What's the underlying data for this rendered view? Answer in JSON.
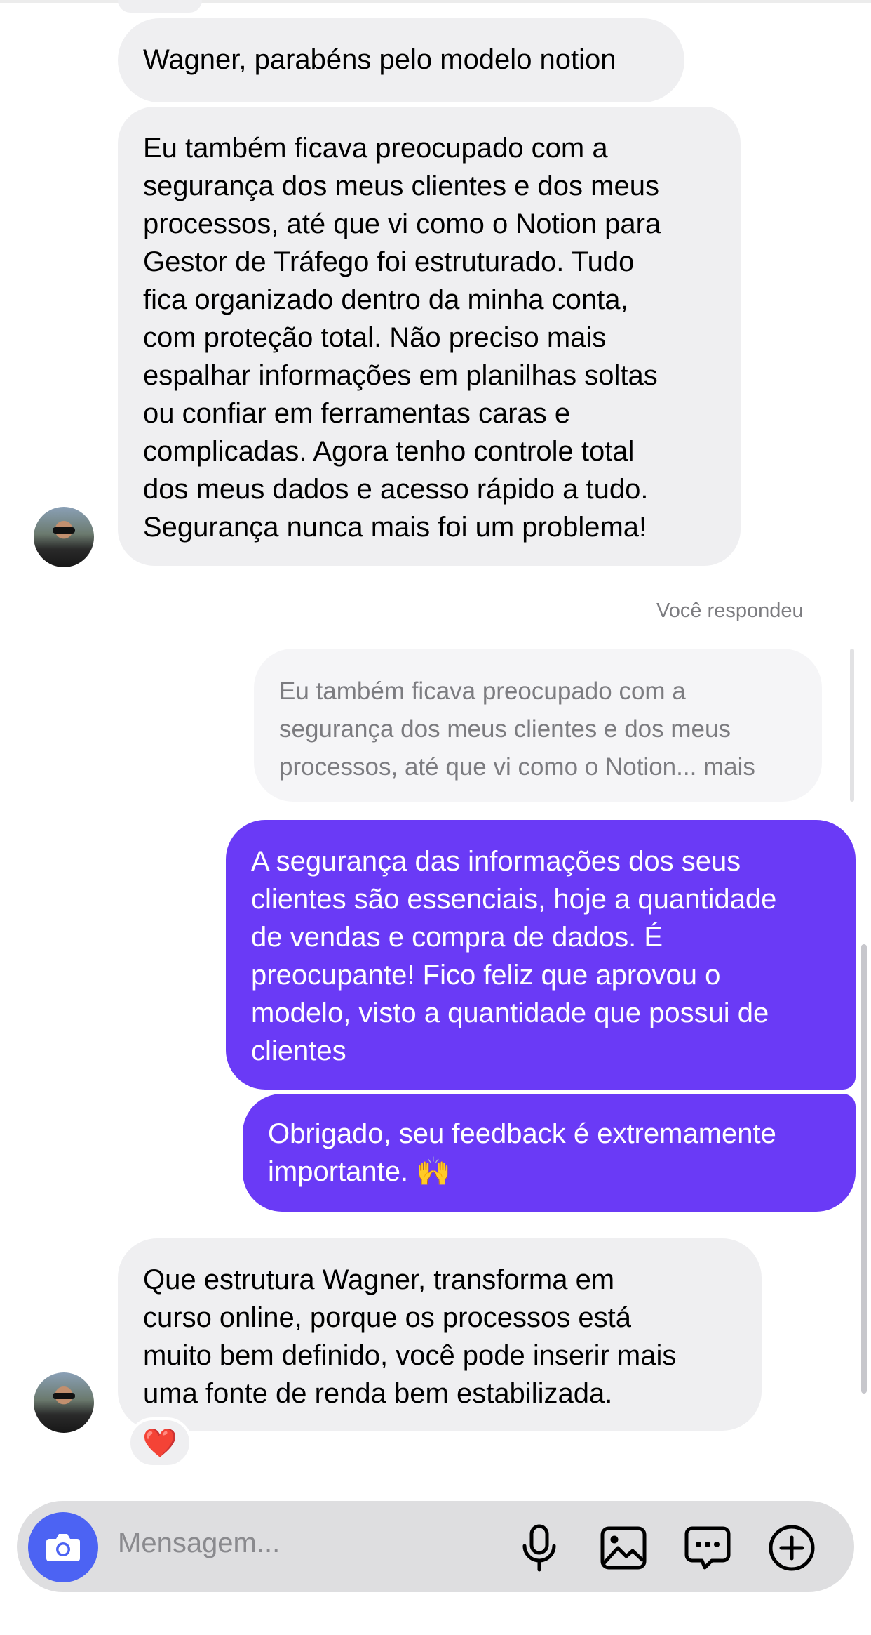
{
  "messages": {
    "m1": "Wagner, parabéns pelo modelo notion",
    "m2_lines": [
      "Eu também ficava preocupado com a",
      "segurança dos meus clientes e dos meus",
      "processos, até que vi como o Notion para",
      "Gestor de Tráfego foi estruturado. Tudo",
      "fica organizado dentro da minha conta,",
      "com proteção total. Não preciso mais",
      "espalhar informações em planilhas soltas",
      "ou confiar em ferramentas caras e",
      "complicadas. Agora tenho controle total",
      "dos meus dados e acesso rápido a tudo.",
      "Segurança nunca mais foi um problema!"
    ],
    "replied_label": "Você respondeu",
    "quote_lines": [
      "Eu também ficava preocupado com a",
      "segurança dos meus clientes e dos meus",
      "processos, até que vi como o Notion... mais"
    ],
    "out1_lines": [
      "A segurança das informações dos seus",
      "clientes são essenciais, hoje a quantidade",
      "de vendas e compra de dados. É",
      "preocupante! Fico feliz que aprovou o",
      "modelo, visto a quantidade que possui de",
      "clientes"
    ],
    "out2_lines": [
      "Obrigado, seu feedback é extremamente",
      "importante. 🙌"
    ],
    "in3_lines": [
      "Que estrutura Wagner, transforma em",
      "curso online, porque os processos está",
      "muito bem definido, você pode inserir mais",
      "uma fonte de renda bem estabilizada."
    ],
    "reaction": "❤️"
  },
  "composer": {
    "placeholder": "Mensagem...",
    "icons": [
      "camera-icon",
      "microphone-icon",
      "image-icon",
      "sticker-icon",
      "plus-icon"
    ]
  },
  "colors": {
    "outgoing_bubble": "#6a3af6",
    "incoming_bubble": "#efeff1",
    "camera_button": "#4c63f3"
  }
}
